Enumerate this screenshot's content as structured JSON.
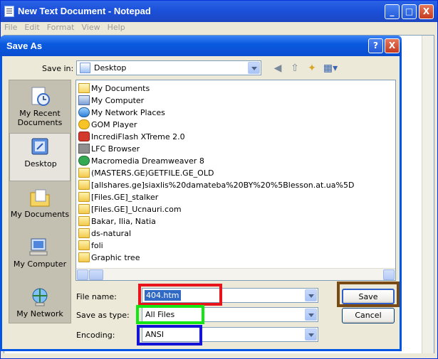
{
  "notepad": {
    "title": "New Text Document - Notepad",
    "menu": [
      "File",
      "Edit",
      "Format",
      "View",
      "Help"
    ],
    "controls": {
      "minimize": "_",
      "maximize": "□",
      "close": "X"
    }
  },
  "dialog": {
    "title": "Save As",
    "help_glyph": "?",
    "close_glyph": "X",
    "save_in_label": "Save in:",
    "save_in_value": "Desktop",
    "places": [
      {
        "label": "My Recent Documents",
        "icon": "recent-documents-icon"
      },
      {
        "label": "Desktop",
        "icon": "desktop-icon"
      },
      {
        "label": "My Documents",
        "icon": "my-documents-icon"
      },
      {
        "label": "My Computer",
        "icon": "my-computer-icon"
      },
      {
        "label": "My Network",
        "icon": "my-network-icon"
      }
    ],
    "files": [
      {
        "name": "My Documents",
        "icon": "my-documents-icon"
      },
      {
        "name": "My Computer",
        "icon": "my-computer-icon"
      },
      {
        "name": "My Network Places",
        "icon": "network-places-icon"
      },
      {
        "name": "GOM Player",
        "icon": "gom-player-icon"
      },
      {
        "name": "IncrediFlash XTreme 2.0",
        "icon": "incrediflash-icon"
      },
      {
        "name": "LFC Browser",
        "icon": "lfc-browser-icon"
      },
      {
        "name": "Macromedia Dreamweaver 8",
        "icon": "dreamweaver-icon"
      },
      {
        "name": "(MASTERS.GE)GETFILE.GE_OLD",
        "icon": "folder-icon"
      },
      {
        "name": "[allshares.ge]siaxlis%20damateba%20BY%20%5Blesson.at.ua%5D",
        "icon": "folder-icon"
      },
      {
        "name": "[Files.GE]_stalker",
        "icon": "folder-icon"
      },
      {
        "name": "[Files.GE]_Ucnauri.com",
        "icon": "folder-icon"
      },
      {
        "name": "Bakar, Ilia, Natia",
        "icon": "folder-icon"
      },
      {
        "name": "ds-natural",
        "icon": "folder-icon"
      },
      {
        "name": "foli",
        "icon": "folder-icon"
      },
      {
        "name": "Graphic tree",
        "icon": "folder-icon"
      }
    ],
    "file_name_label": "File name:",
    "file_name_value": "404.htm",
    "save_as_type_label": "Save as type:",
    "save_as_type_value": "All Files",
    "encoding_label": "Encoding:",
    "encoding_value": "ANSI",
    "save_button": "Save",
    "cancel_button": "Cancel"
  },
  "colors": {
    "filename_highlight": "#e8141c",
    "type_highlight": "#14e614",
    "encoding_highlight": "#1414d6",
    "save_highlight": "#7a4a14"
  }
}
